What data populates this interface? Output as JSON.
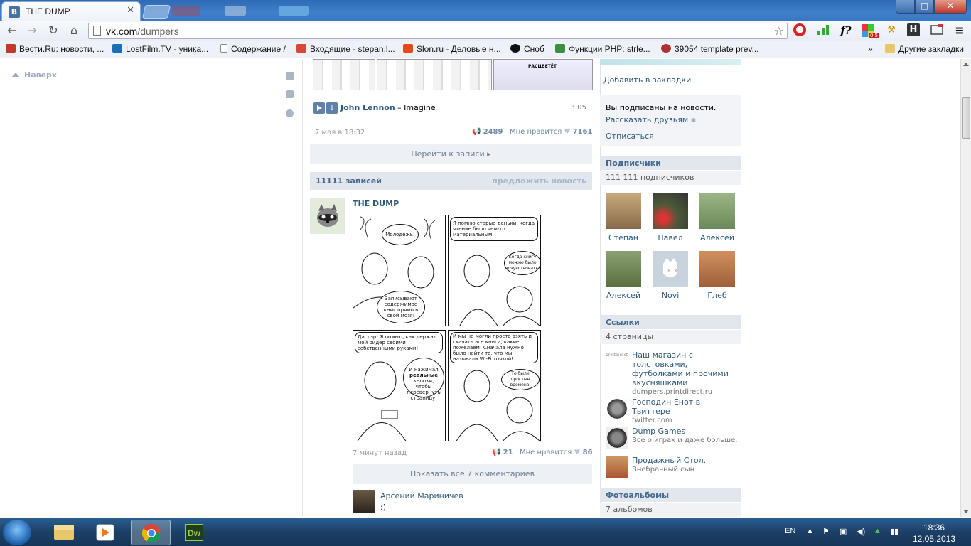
{
  "browser": {
    "tab_title": "THE DUMP",
    "tab_favicon": "B",
    "url_host": "vk.com",
    "url_path": "/dumpers",
    "window_controls": {
      "minimize": "—",
      "maximize": "□",
      "close": "✕"
    }
  },
  "extensions": {
    "f_label": "f?",
    "h_label": "H",
    "badge_label": "0.5"
  },
  "bookmarks": [
    {
      "label": "Вести.Ru: новости, ...",
      "color": "#c0392b"
    },
    {
      "label": "LostFilm.TV - уника...",
      "color": "#1b6fb5"
    },
    {
      "label": "Содержание /",
      "color": "#ffffff"
    },
    {
      "label": "Входящие - stepan.l...",
      "color": "#d9463b"
    },
    {
      "label": "Slon.ru - Деловые н...",
      "color": "#e54a1a"
    },
    {
      "label": "Сноб",
      "color": "#111111"
    },
    {
      "label": "Функции PHP: strle...",
      "color": "#3d8f3d"
    },
    {
      "label": "39054 template prev...",
      "color": "#b03030"
    }
  ],
  "bookmarks_more": "»",
  "bookmarks_other": "Другие закладки",
  "page": {
    "back_to_top": "Наверх",
    "audio": {
      "artist": "John Lennon",
      "separator": " – ",
      "title": "Imagine",
      "duration": "3:05"
    },
    "prev_post": {
      "date": "7 мая в 18:32",
      "shares": "2489",
      "likes_label": "Мне нравится",
      "likes": "7161",
      "open_post": "Перейти к записи"
    },
    "wall": {
      "count": "11111 записей",
      "suggest": "предложить новость"
    },
    "post": {
      "author": "THE DUMP",
      "time": "7 минут назад",
      "shares": "21",
      "likes_label": "Мне нравится",
      "likes": "86",
      "show_comments": "Показать все 7 комментариев",
      "comic": {
        "p1_top": "Молодёжь!",
        "p1_bottom": "Записывают содержимое книг прямо в свой мозг!",
        "p2_top": "Я помню старые деньки, когда чтение было чем-то материальным!",
        "p2_side": "Когда книгу можно было почувствовать!",
        "p3_top": "Да, сэр! Я помню, как держал мой ридер своими собственными руками!",
        "p3_pre": "И нажимал",
        "p3_bold": "реальные",
        "p3_post": "кнопки, чтобы перевернуть страницу.",
        "p4_top": "И мы не могли просто взять и скачать все книги, какие пожелаем! Сначала нужно было найти то, что мы называли Wi-Fi точкой!",
        "p4_side": "То были простые времена."
      },
      "comment": {
        "author": "Арсений Мариничев",
        "text": ":)"
      }
    },
    "right": {
      "add_bookmark": "Добавить в закладки",
      "subscribed": "Вы подписаны на новости.",
      "tell_friends": "Рассказать друзьям",
      "unsubscribe": "Отписаться",
      "subscribers_title": "Подписчики",
      "subscribers_count": "111 111 подписчиков",
      "members": [
        {
          "name": "Степан",
          "color": "#8a6b4a"
        },
        {
          "name": "Павел",
          "color": "#4c5a3a"
        },
        {
          "name": "Алексей",
          "color": "#6a8a5a"
        },
        {
          "name": "Алексей",
          "color": "#5b7040"
        },
        {
          "name": "Novi",
          "color": "#c9d3de"
        },
        {
          "name": "Глеб",
          "color": "#a0603a"
        }
      ],
      "links_title": "Ссылки",
      "links_count": "4 страницы",
      "links": [
        {
          "icon_label": "printdirect",
          "title": "Наш магазин с толстовками, футболками и прочими вкусняшками",
          "sub": "dumpers.printdirect.ru"
        },
        {
          "icon_label": "",
          "title": "Господин Енот в Твиттере",
          "sub": "twitter.com"
        },
        {
          "icon_label": "",
          "title": "Dump Games",
          "sub": "Все о играх и даже больше."
        },
        {
          "icon_label": "",
          "title": "Продажный Стол.",
          "sub": "Внебрачный сын"
        }
      ],
      "albums_title": "Фотоальбомы",
      "albums_count": "7 альбомов",
      "calendar_label": "РАСЦВЕТЁТ"
    }
  },
  "taskbar": {
    "lang": "EN",
    "time": "18:36",
    "date": "12.05.2013",
    "dw_label": "Dw"
  }
}
